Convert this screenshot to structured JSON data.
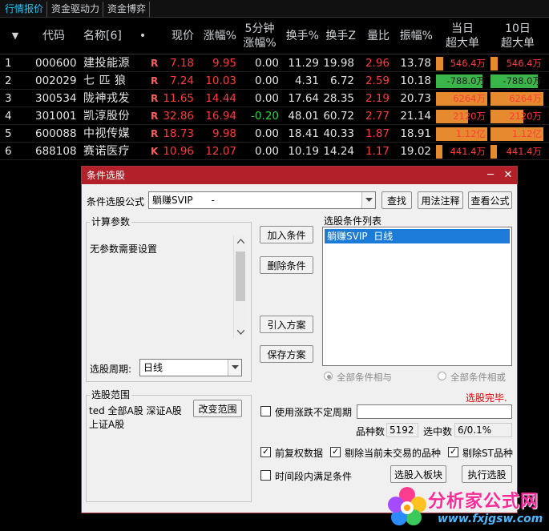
{
  "top_tabs": [
    "行情报价",
    "资金驱动力",
    "资金博弈"
  ],
  "table": {
    "headers": {
      "sort": "▼",
      "code": "代码",
      "name": "名称[6]",
      "dot": "•",
      "price": "现价",
      "change": "涨幅%",
      "min5_l1": "5分钟",
      "min5_l2": "涨幅%",
      "turnover": "换手%",
      "turnover_z": "换手Z",
      "vol_ratio": "量比",
      "amplitude": "振幅%",
      "day_l1": "当日",
      "day_l2": "超大单",
      "d10_l1": "10日",
      "d10_l2": "超大单"
    },
    "rows": [
      {
        "idx": "1",
        "code": "000600",
        "name": "建投能源",
        "flag": "R",
        "price": "7.18",
        "change": "9.95",
        "min5": "0.00",
        "turnover": "11.29",
        "turnover_z": "19.98",
        "vol_ratio": "2.96",
        "amplitude": "13.78",
        "day": "546.4万",
        "day_frac": 0.14,
        "day_sign": "pos",
        "d10": "546.4万",
        "d10_frac": 0.14,
        "d10_sign": "pos"
      },
      {
        "idx": "2",
        "code": "002029",
        "name": "七 匹 狼",
        "flag": "R",
        "price": "7.24",
        "change": "10.03",
        "min5": "0.00",
        "turnover": "4.31",
        "turnover_z": "6.72",
        "vol_ratio": "2.59",
        "amplitude": "10.18",
        "day": "-788.0万",
        "day_frac": 0.9,
        "day_sign": "neg",
        "d10": "-788.0万",
        "d10_frac": 0.9,
        "d10_sign": "neg"
      },
      {
        "idx": "3",
        "code": "300534",
        "name": "陇神戎发",
        "flag": "R",
        "price": "11.65",
        "change": "14.44",
        "min5": "0.00",
        "turnover": "17.64",
        "turnover_z": "28.35",
        "vol_ratio": "2.19",
        "amplitude": "20.73",
        "day": "6264万",
        "day_frac": 1.0,
        "day_sign": "pos",
        "d10": "6264万",
        "d10_frac": 1.0,
        "d10_sign": "pos"
      },
      {
        "idx": "4",
        "code": "301001",
        "name": "凯淳股份",
        "flag": "R",
        "price": "32.86",
        "change": "16.94",
        "min5": "-0.20",
        "turnover": "48.01",
        "turnover_z": "60.72",
        "vol_ratio": "2.77",
        "amplitude": "21.14",
        "day": "2120万",
        "day_frac": 0.62,
        "day_sign": "pos",
        "d10": "2120万",
        "d10_frac": 0.62,
        "d10_sign": "pos"
      },
      {
        "idx": "5",
        "code": "600088",
        "name": "中视传媒",
        "flag": "R",
        "price": "18.73",
        "change": "9.98",
        "min5": "0.00",
        "turnover": "18.41",
        "turnover_z": "40.33",
        "vol_ratio": "1.87",
        "amplitude": "18.91",
        "day": "1.12亿",
        "day_frac": 1.0,
        "day_sign": "pos",
        "d10": "1.12亿",
        "d10_frac": 1.0,
        "d10_sign": "pos"
      },
      {
        "idx": "6",
        "code": "688108",
        "name": "赛诺医疗",
        "flag": "K",
        "price": "10.96",
        "change": "12.07",
        "min5": "0.00",
        "turnover": "10.19",
        "turnover_z": "14.24",
        "vol_ratio": "1.17",
        "amplitude": "19.02",
        "day": "441.4万",
        "day_frac": 0.12,
        "day_sign": "pos",
        "d10": "441.4万",
        "d10_frac": 0.12,
        "d10_sign": "pos"
      }
    ]
  },
  "dialog": {
    "title": "条件选股",
    "min_btn": "─",
    "close_btn": "✕",
    "formula_label": "条件选股公式",
    "formula_value": "躺赚SVIP      -",
    "find_btn": "查找",
    "usage_btn": "用法注释",
    "view_btn": "查看公式",
    "params_group": "计算参数",
    "params_text": "无参数需要设置",
    "add_btn": "加入条件",
    "remove_btn": "删除条件",
    "import_btn": "引入方案",
    "save_btn": "保存方案",
    "cond_list_label": "选股条件列表",
    "cond_items": [
      "躺赚SVIP  日线"
    ],
    "period_label": "选股周期:",
    "period_value": "日线",
    "radio_and": "全部条件相与",
    "radio_or": "全部条件相或",
    "status": "选股完毕.",
    "range_group": "选股范围",
    "range_text_1": "ted 全部A股 深证A股",
    "range_text_2": "上证A股",
    "change_range_btn": "改变范围",
    "use_period_label": "使用涨跌不定周期",
    "count_label": "品种数",
    "count_value": "5192",
    "selected_label": "选中数",
    "selected_value": "6/0.1%",
    "adj_label": "前复权数据",
    "excl_untraded_label": "剔除当前未交易的品种",
    "excl_st_label": "剔除ST品种",
    "time_range_label": "时间段内满足条件",
    "to_block_btn": "选股入板块",
    "run_btn": "执行选股"
  },
  "watermark": {
    "title": "分析家公式网",
    "url": "www.fxjgsw.com"
  }
}
